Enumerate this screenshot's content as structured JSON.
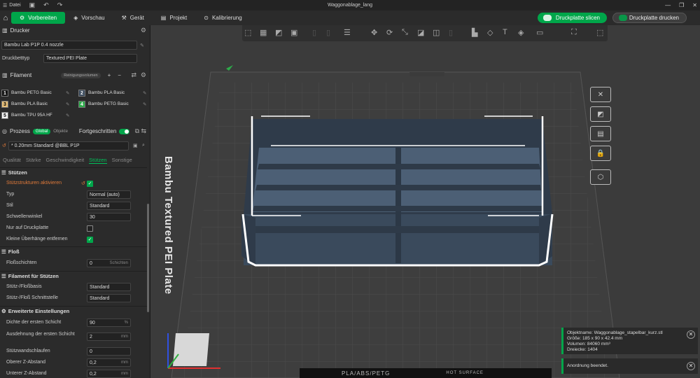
{
  "window": {
    "title": "Waggonablage_lang",
    "menu_label": "Datei"
  },
  "topbar": {
    "tabs": [
      {
        "label": "Vorbereiten",
        "active": true
      },
      {
        "label": "Vorschau"
      },
      {
        "label": "Gerät"
      },
      {
        "label": "Projekt"
      },
      {
        "label": "Kalibrierung"
      }
    ],
    "slice_label": "Druckplatte slicen",
    "print_label": "Druckplatte drucken"
  },
  "printer": {
    "section_label": "Drucker",
    "name": "Bambu Lab P1P 0.4 nozzle",
    "bed_type_label": "Druckbetttyp",
    "bed_type_value": "Textured PEI Plate"
  },
  "filament": {
    "section_label": "Filament",
    "flush_label": "Reinigungsvolumen",
    "items": [
      {
        "num": "1",
        "name": "Bambu PETG Basic",
        "color": "#111111",
        "text": "#ffffff"
      },
      {
        "num": "2",
        "name": "Bambu PLA Basic",
        "color": "#3a4a5c",
        "text": "#ffffff"
      },
      {
        "num": "3",
        "name": "Bambu PLA Basic",
        "color": "#e8c07a",
        "text": "#000000"
      },
      {
        "num": "4",
        "name": "Bambu PETG Basic",
        "color": "#2dab4a",
        "text": "#ffffff"
      },
      {
        "num": "5",
        "name": "Bambu TPU 95A HF",
        "color": "#f4f4f4",
        "text": "#000000"
      }
    ]
  },
  "process": {
    "section_label": "Prozess",
    "global_label": "Global",
    "objects_label": "Objekte",
    "advanced_label": "Fortgeschritten",
    "preset": "* 0.20mm Standard @BBL P1P",
    "tabs": [
      "Qualität",
      "Stärke",
      "Geschwindigkeit",
      "Stützen",
      "Sonstige"
    ],
    "active_tab": "Stützen"
  },
  "settings": {
    "supports_title": "Stützen",
    "enable_support": "Stützstrukturen aktivieren",
    "type_label": "Typ",
    "type_value": "Normal (auto)",
    "style_label": "Stil",
    "style_value": "Standard",
    "threshold_label": "Schwellenwinkel",
    "threshold_value": "30",
    "only_plate_label": "Nur auf Druckplatte",
    "remove_small_label": "Kleine Überhänge entfernen",
    "raft_title": "Floß",
    "raft_layers_label": "Floßschichten",
    "raft_layers_value": "0",
    "raft_layers_unit": "Schichten",
    "support_filament_title": "Filament für Stützen",
    "base_label": "Stütz-/Floßbasis",
    "base_value": "Standard",
    "interface_label": "Stütz-/Floß Schnittstelle",
    "interface_value": "Standard",
    "advanced_title": "Erweiterte Einstellungen",
    "first_density_label": "Dichte der ersten Schicht",
    "first_density_value": "90",
    "first_density_unit": "%",
    "first_expand_label": "Ausdehnung der ersten Schicht",
    "first_expand_value": "2",
    "first_expand_unit": "mm",
    "wall_loops_label": "Stützwandschlaufen",
    "wall_loops_value": "0",
    "top_z_label": "Oberer Z-Abstand",
    "top_z_value": "0,2",
    "top_z_unit": "mm",
    "bottom_z_label": "Unterer Z-Abstand",
    "bottom_z_value": "0,2",
    "bottom_z_unit": "mm"
  },
  "viewport": {
    "bed_label": "Bambu Textured PEI Plate",
    "strip_text": "PLA/ABS/PETG",
    "strip_text2": "HOT SURFACE"
  },
  "notifications": {
    "object_name": "Objektname: Waggonablage_stapelbar_kurz.stl",
    "size": "Größe: 185 x 90 x 42.4 mm",
    "volume": "Volumen: 84060 mm³",
    "triangles": "Dreiecke: 1404",
    "done": "Anordnung beendet."
  }
}
